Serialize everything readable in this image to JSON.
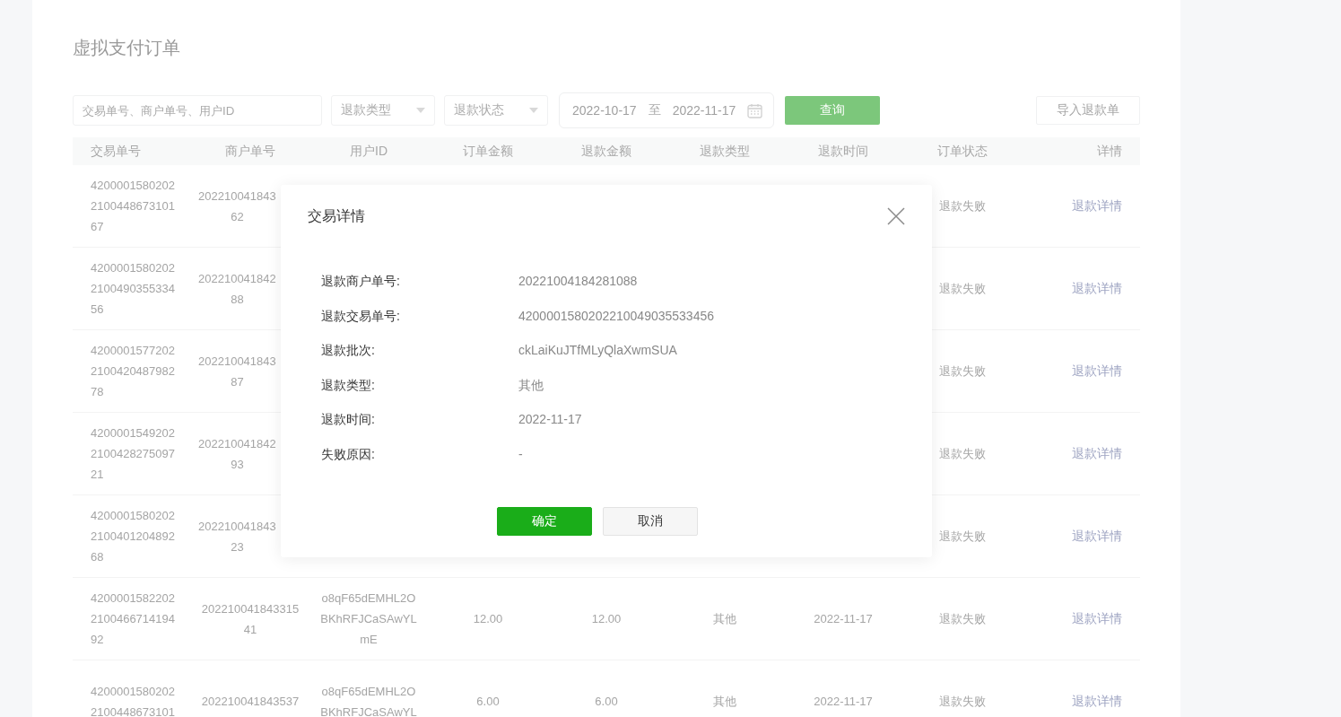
{
  "page_title": "虚拟支付订单",
  "filters": {
    "search": {
      "placeholder": "交易单号、商户单号、用户ID"
    },
    "refund_type": {
      "placeholder": "退款类型"
    },
    "refund_status": {
      "placeholder": "退款状态"
    },
    "date_start": "2022-10-17",
    "date_separator": "至",
    "date_end": "2022-11-17",
    "query_button": {
      "label": "查询",
      "disabled": true
    },
    "import_button": "导入退款单"
  },
  "table": {
    "columns": [
      "交易单号",
      "商户单号",
      "用户ID",
      "订单金额",
      "退款金额",
      "退款类型",
      "退款时间",
      "订单状态",
      "详情"
    ],
    "rows": [
      {
        "transaction_no": [
          "4200001580202",
          "2100448673101",
          "67"
        ],
        "merchant_no": [
          "202210041843",
          "62"
        ],
        "status": "退款失败",
        "detail_link": "退款详情"
      },
      {
        "transaction_no": [
          "4200001580202",
          "2100490355334",
          "56"
        ],
        "merchant_no": [
          "202210041842",
          "88"
        ],
        "status": "退款失败",
        "detail_link": "退款详情"
      },
      {
        "transaction_no": [
          "4200001577202",
          "2100420487982",
          "78"
        ],
        "merchant_no": [
          "202210041843",
          "87"
        ],
        "status": "退款失败",
        "detail_link": "退款详情"
      },
      {
        "transaction_no": [
          "4200001549202",
          "2100428275097",
          "21"
        ],
        "merchant_no": [
          "202210041842",
          "93"
        ],
        "status": "退款失败",
        "detail_link": "退款详情"
      },
      {
        "transaction_no": [
          "4200001580202",
          "2100401204892",
          "68"
        ],
        "merchant_no": [
          "202210041843",
          "23"
        ],
        "status": "退款失败",
        "detail_link": "退款详情"
      },
      {
        "transaction_no": [
          "4200001582202",
          "2100466714194",
          "92"
        ],
        "merchant_no": [
          "202210041843315",
          "41"
        ],
        "user_id": [
          "o8qF65dEMHL2O",
          "BKhRFJCaSAwYL",
          "mE"
        ],
        "order_amount": "12.00",
        "refund_amount": "12.00",
        "refund_type": "其他",
        "refund_time": "2022-11-17",
        "status": "退款失败",
        "detail_link": "退款详情"
      },
      {
        "transaction_no": [
          "4200001580202",
          "2100448673101"
        ],
        "merchant_no": [
          "202210041843537"
        ],
        "user_id": [
          "o8qF65dEMHL2O",
          "BKhRFJCaSAwYL"
        ],
        "order_amount": "6.00",
        "refund_amount": "6.00",
        "refund_type": "其他",
        "refund_time": "2022-11-17",
        "status": "退款失败",
        "detail_link": "退款详情"
      }
    ]
  },
  "dialog": {
    "title": "交易详情",
    "fields": [
      {
        "label": "退款商户单号:",
        "value": "20221004184281088"
      },
      {
        "label": "退款交易单号:",
        "value": "4200001580202210049035533456"
      },
      {
        "label": "退款批次:",
        "value": "ckLaiKuJTfMLyQlaXwmSUA"
      },
      {
        "label": "退款类型:",
        "value": "其他"
      },
      {
        "label": "退款时间:",
        "value": "2022-11-17"
      },
      {
        "label": "失败原因:",
        "value": "-"
      }
    ],
    "buttons": [
      {
        "label": "确定",
        "kind": "primary"
      },
      {
        "label": "取消",
        "kind": "default"
      }
    ]
  }
}
